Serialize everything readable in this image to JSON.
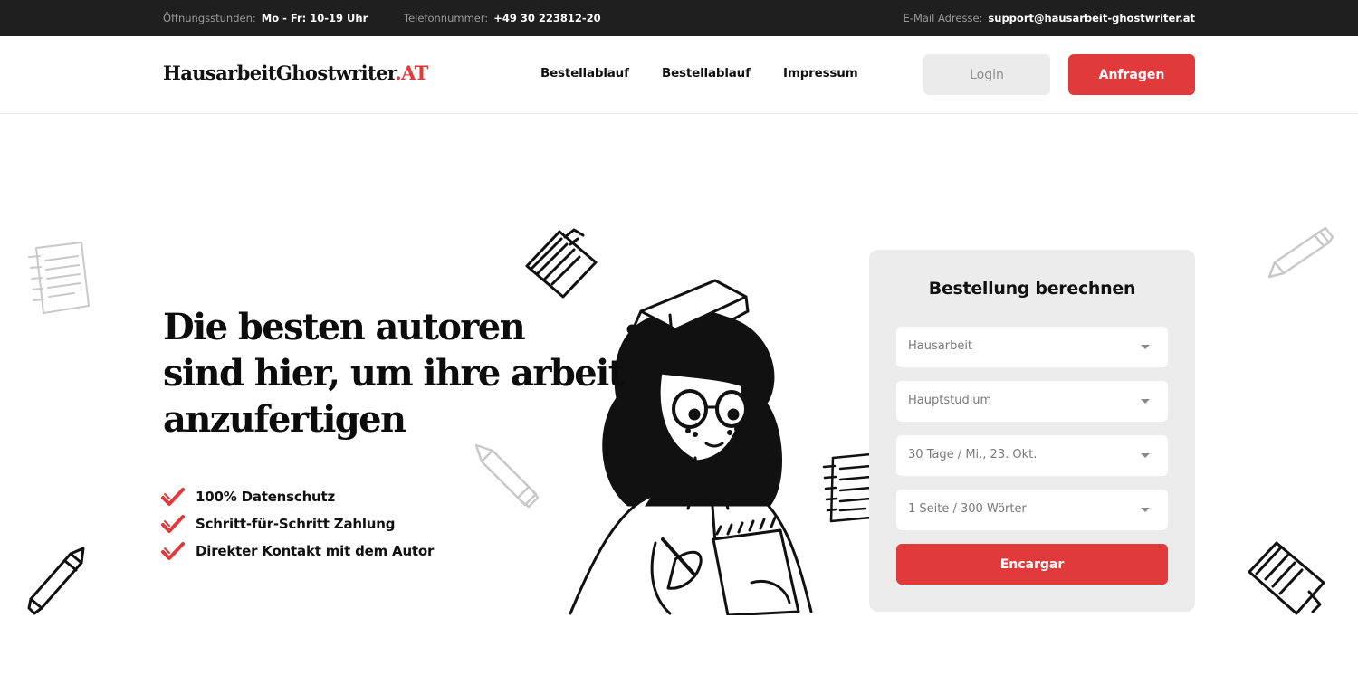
{
  "topbar": {
    "hours_label": "Öffnungsstunden:",
    "hours_value": "Mo - Fr: 10-19 Uhr",
    "phone_label": "Telefonnummer:",
    "phone_value": "+49 30 223812-20",
    "email_label": "E-Mail Adresse:",
    "email_value": "support@hausarbeit-ghostwriter.at"
  },
  "header": {
    "logo_main": "HausarbeitGhostwriter",
    "logo_accent": ".AT",
    "nav": [
      "Bestellablauf",
      "Bestellablauf",
      "Impressum"
    ],
    "login_label": "Login",
    "cta_label": "Anfragen"
  },
  "hero": {
    "title_lines": [
      "Die besten autoren",
      "sind hier, um ihre arbeit",
      "anzufertigen"
    ],
    "features": [
      "100% Datenschutz",
      "Schritt-für-Schritt Zahlung",
      "Direkter Kontakt mit dem Autor"
    ]
  },
  "order_form": {
    "title": "Bestellung berechnen",
    "selects": [
      "Hausarbeit",
      "Hauptstudium",
      "30 Tage / Mi., 23. Okt.",
      "1 Seite / 300 Wörter"
    ],
    "submit_label": "Encargar"
  },
  "icons": {
    "check": "check-icon",
    "caret": "caret-down-icon",
    "notes": "notes-icon",
    "book": "book-icon",
    "pencil": "pencil-icon",
    "graduate": "student-illustration"
  },
  "colors": {
    "accent": "#e13a3a",
    "topbar": "#1f1f1f",
    "card": "#ececec"
  }
}
